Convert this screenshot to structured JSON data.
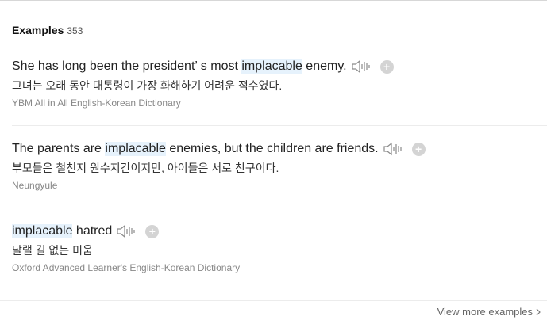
{
  "examples_section": {
    "title": "Examples",
    "count": "353"
  },
  "examples": [
    {
      "en_before": "She has long been the president’ s most ",
      "en_highlight": "implacable",
      "en_after": " enemy.",
      "ko": "그녀는 오래 동안 대통령이 가장 화해하기 어려운 적수였다.",
      "source": "YBM All in All English-Korean Dictionary"
    },
    {
      "en_before": "The parents are ",
      "en_highlight": "implacable",
      "en_after": " enemies, but the children are friends.",
      "ko": "부모들은 철천지 원수지간이지만, 아이들은 서로 친구이다.",
      "source": "Neungyule"
    },
    {
      "en_before": "",
      "en_highlight": "implacable",
      "en_after": " hatred",
      "ko": "달랠 길 없는 미움",
      "source": "Oxford Advanced Learner's English-Korean Dictionary"
    }
  ],
  "icons": {
    "speaker": "speaker-icon",
    "add": "plus-icon",
    "chevron": "chevron-right-icon",
    "plus_glyph": "+"
  },
  "colors": {
    "highlight": "#e6f2fc",
    "source_text": "#888888"
  },
  "footer": {
    "view_more_label": "View more examples"
  }
}
